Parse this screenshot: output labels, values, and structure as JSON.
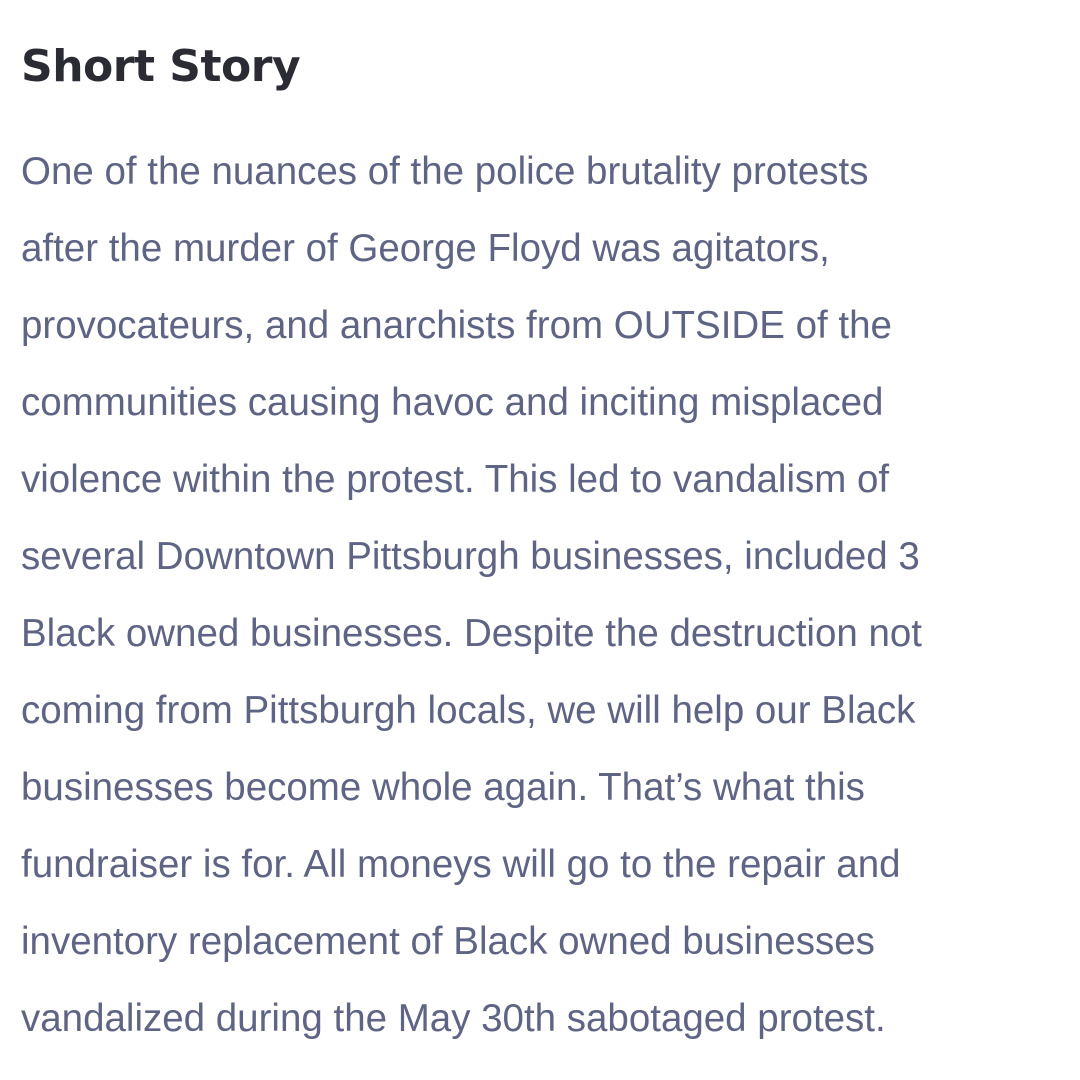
{
  "section": {
    "title": "Short Story",
    "lines": [
      "One of the nuances of the police brutality protests",
      "after the murder of George Floyd was agitators,",
      "provocateurs, and anarchists from OUTSIDE of the",
      "communities causing havoc and inciting misplaced",
      "violence within the protest. This led to vandalism of",
      "several Downtown Pittsburgh businesses, included 3",
      "Black owned businesses. Despite the destruction not",
      "coming from Pittsburgh locals, we will help our Black",
      "businesses become whole again. That’s what this",
      "fundraiser is for. All moneys will go to the repair and",
      "inventory replacement of Black owned businesses",
      "vandalized during the May 30th sabotaged protest."
    ]
  },
  "colors": {
    "title": "#2b2c33",
    "body": "#5f6485",
    "background": "#ffffff"
  }
}
